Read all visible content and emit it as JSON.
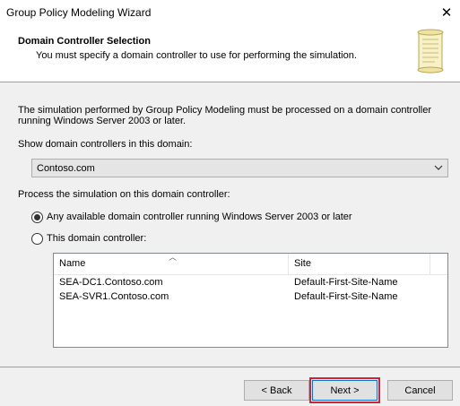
{
  "window": {
    "title": "Group Policy Modeling Wizard",
    "close_glyph": "✕"
  },
  "header": {
    "title": "Domain Controller Selection",
    "subtitle": "You must specify a domain controller to use for performing the simulation.",
    "icon": "scroll-icon"
  },
  "body": {
    "intro": "The simulation performed by Group Policy Modeling must be processed on a domain controller running Windows Server 2003 or later.",
    "domain_label": "Show domain controllers in this domain:",
    "domain_value": "Contoso.com",
    "process_label": "Process the simulation on this domain controller:"
  },
  "options": {
    "any_dc": "Any available domain controller running Windows Server 2003 or later",
    "this_dc": "This domain controller:",
    "selected": "any_dc"
  },
  "list": {
    "columns": [
      "Name",
      "Site"
    ],
    "rows": [
      {
        "name": "SEA-DC1.Contoso.com",
        "site": "Default-First-Site-Name"
      },
      {
        "name": "SEA-SVR1.Contoso.com",
        "site": "Default-First-Site-Name"
      }
    ]
  },
  "buttons": {
    "back": "< Back",
    "next": "Next >",
    "cancel": "Cancel"
  },
  "colors": {
    "highlight_outline": "#d92231",
    "focus_border": "#0078d7"
  }
}
